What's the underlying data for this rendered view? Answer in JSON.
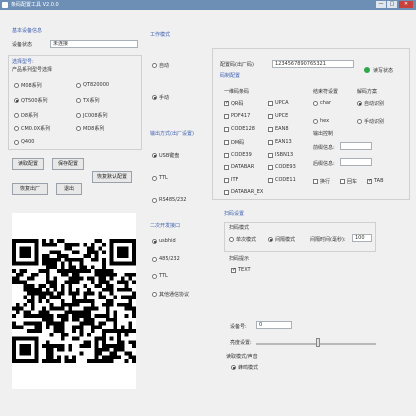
{
  "window": {
    "title": "条码配置工具 V2.0.0",
    "min": "—",
    "max": "□",
    "close": "✕"
  },
  "left": {
    "info_section": "基本设备信息",
    "device_label": "设备状态",
    "device_value": "未连接",
    "model_section": "选择型号:",
    "model_sub": "产品系列型号选择",
    "models": [
      {
        "label": "M08系列",
        "on": false
      },
      {
        "label": "QT820000",
        "on": false
      },
      {
        "label": "QT500系列",
        "on": true
      },
      {
        "label": "TX系列",
        "on": false
      },
      {
        "label": "D8系列",
        "on": false
      },
      {
        "label": "JC008系列",
        "on": false
      },
      {
        "label": "CM0.0X系列",
        "on": false
      },
      {
        "label": "MD8系列",
        "on": false
      },
      {
        "label": "Q400",
        "on": false
      }
    ],
    "btn_read": "读取配置",
    "btn_save": "保存配置",
    "btn_default": "恢复出厂",
    "btn_exit": "退出",
    "btn_default_cfg": "恢复默认配置"
  },
  "mid": {
    "work_section": "工作模式",
    "work_modes": [
      {
        "label": "自动",
        "on": false
      },
      {
        "label": "手动",
        "on": true
      }
    ],
    "out_section": "输出方式(出厂设置)",
    "outputs": [
      {
        "label": "USB键盘",
        "on": true
      },
      {
        "label": "TTL",
        "on": false
      },
      {
        "label": "RS485/232",
        "on": false
      }
    ],
    "iface_section": "二次开发接口",
    "ifaces": [
      {
        "label": "usbhid",
        "on": true
      },
      {
        "label": "485/232",
        "on": false
      },
      {
        "label": "TTL",
        "on": false
      },
      {
        "label": "其他通信协议",
        "on": false
      }
    ]
  },
  "right": {
    "cfg_label": "配置码(出厂码)",
    "cfg_value": "1234567890765321",
    "status_label": "读写状态",
    "type_section": "码制配置",
    "one_d_label": "一维码条码",
    "codes": [
      {
        "label": "QR码",
        "on": true
      },
      {
        "label": "UPCA",
        "on": false
      },
      {
        "label": "PDF417",
        "on": false
      },
      {
        "label": "UPCE",
        "on": false
      },
      {
        "label": "CODE128",
        "on": false
      },
      {
        "label": "EAN8",
        "on": false
      },
      {
        "label": "DM码",
        "on": false
      },
      {
        "label": "EAN13",
        "on": false
      },
      {
        "label": "CODE39",
        "on": false
      },
      {
        "label": "ISBN13",
        "on": false
      },
      {
        "label": "DATABAR",
        "on": false
      },
      {
        "label": "CODE93",
        "on": false
      },
      {
        "label": "ITF",
        "on": false
      },
      {
        "label": "CODE11",
        "on": false
      },
      {
        "label": "DATABAR_EX",
        "on": false
      }
    ],
    "term_section": "结束符设置",
    "term_opts": [
      {
        "label": "char",
        "on": false
      },
      {
        "label": "hex",
        "on": false
      }
    ],
    "decode_section": "解码方案",
    "decode_opts": [
      {
        "label": "自动识别",
        "on": true
      },
      {
        "label": "手动识别",
        "on": false
      }
    ],
    "prefix_section": "输出控制",
    "prefix_label": "前缀信息:",
    "suffix_label": "后缀信息:",
    "extra_opts": [
      {
        "label": "换行",
        "on": false
      },
      {
        "label": "回车",
        "on": false
      },
      {
        "label": "TAB",
        "on": true
      }
    ],
    "scan_section": "扫码设置",
    "scan_mode_label": "扫码模式",
    "scan_modes": [
      {
        "label": "单次模式",
        "on": false
      },
      {
        "label": "间隔模式",
        "on": true
      }
    ],
    "interval_label": "间隔时间(毫秒):",
    "interval_value": "100",
    "beep_label": "扫码提示",
    "beep_opt": {
      "label": "TEXT",
      "on": true
    },
    "device_no_label": "设备号:",
    "device_no_value": "0",
    "light_label": "亮度设置:",
    "light_level": 0.52,
    "voice_label": "读取模式/声音",
    "voice_opt": {
      "label": "蜂鸣模式",
      "on": true
    }
  },
  "colors": {
    "accent": "#3c5fb0",
    "status_ok": "#2fa84a"
  }
}
